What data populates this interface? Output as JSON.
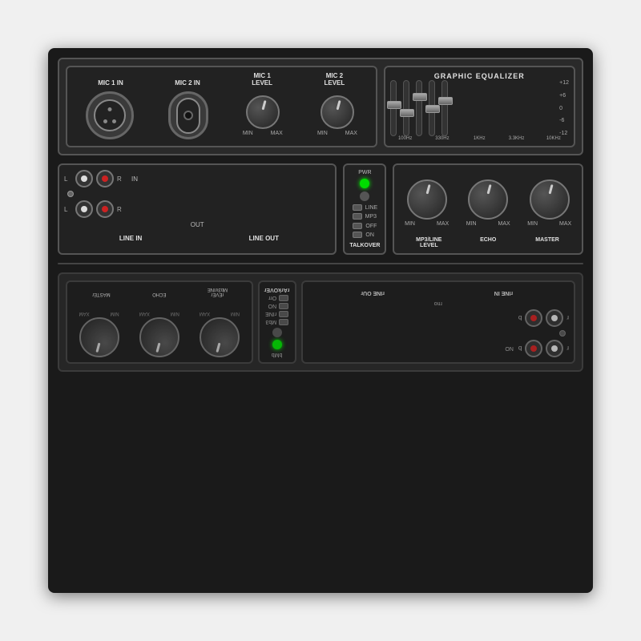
{
  "device": {
    "top_panel": {
      "mic1_label": "MIC 1 IN",
      "mic2_label": "MIC 2 IN",
      "mic1_level_label": "MIC 1\nLEVEL",
      "mic2_level_label": "MIC 2\nLEVEL",
      "eq_title": "GRAPHIC EQUALIZER",
      "eq_scales": [
        "+12",
        "+6",
        "0",
        "-6",
        "-12"
      ],
      "eq_freqs": [
        "100Hz",
        "330Hz",
        "1KHz",
        "3.3KHz",
        "10KHz"
      ],
      "eq_slider_positions": [
        40,
        55,
        25,
        45,
        30
      ],
      "min_label": "MIN",
      "max_label": "MAX"
    },
    "middle_panel": {
      "line_in_label": "LINE IN",
      "line_out_label": "LINE OUT",
      "talkover_label": "TALKOVER",
      "in_label": "IN",
      "out_label": "OUT",
      "l_label": "L",
      "r_label": "R",
      "pwr_label": "PWR",
      "line_switch": "LINE",
      "mp3_switch": "MP3",
      "off_switch": "OFF",
      "on_switch": "ON",
      "knobs": {
        "mp3line_label": "MP3/LINE\nLEVEL",
        "echo_label": "ECHO",
        "master_label": "MASTER",
        "min_label": "MIN",
        "max_label": "MAX"
      }
    },
    "reflection": {
      "line_in": "rINE IN",
      "line_out": "rINE OUr",
      "talkover": "rArkOVEr",
      "mp3line": "rEVEr\nMb3\\rINE",
      "echo": "ECHO",
      "master": "MASTEr"
    }
  }
}
